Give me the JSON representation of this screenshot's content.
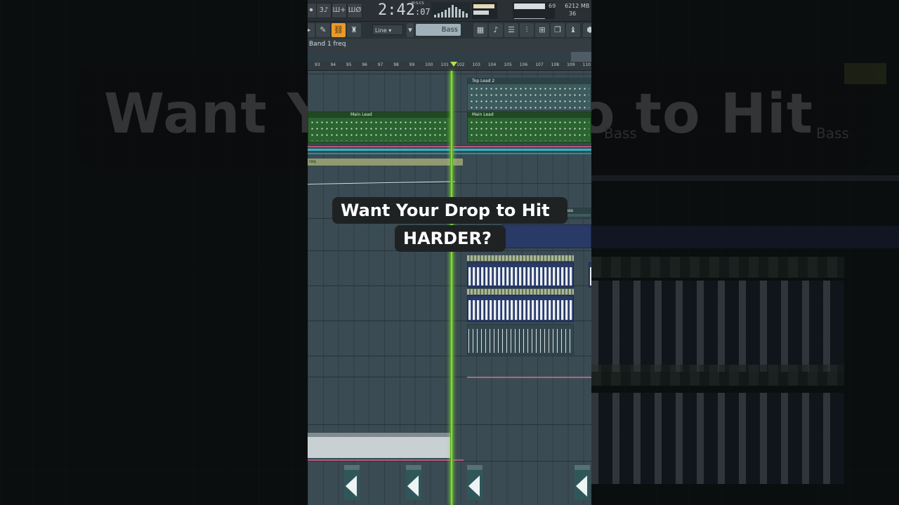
{
  "background_overlay": {
    "caption_ghost": "Want Your Drop to Hit",
    "left_ghost": "Want Y",
    "right_ghost": "o to Hit",
    "right_clip_label_1": "Bass",
    "right_clip_label_2": "Bass"
  },
  "daw": {
    "toolbar": {
      "time_main": "2:42",
      "time_sub": ":07",
      "time_unit": "M:S:CS",
      "cpu_value": "69",
      "memory": "6212 MB",
      "voices": "36",
      "snap_mode": "Line",
      "preset_name": "Bass"
    },
    "automation_param": "Band 1 freq",
    "ruler_ticks": [
      "93",
      "94",
      "95",
      "96",
      "97",
      "98",
      "99",
      "100",
      "101",
      "102",
      "103",
      "104",
      "105",
      "106",
      "107",
      "108",
      "109",
      "110"
    ],
    "clips": {
      "top_lead": "Top Lead 2",
      "main_lead_1": "Main Lead",
      "main_lead_2": "Main Lead",
      "auto_clip": "req",
      "bass_clip": "Bass"
    }
  },
  "caption": {
    "line1": "Want Your Drop to Hit",
    "line2": "HARDER?"
  },
  "colors": {
    "playhead": "#a6ee45",
    "note_clip": "#2b6431",
    "audio_clip": "#2a3a66",
    "active_button": "#e89a2c"
  }
}
